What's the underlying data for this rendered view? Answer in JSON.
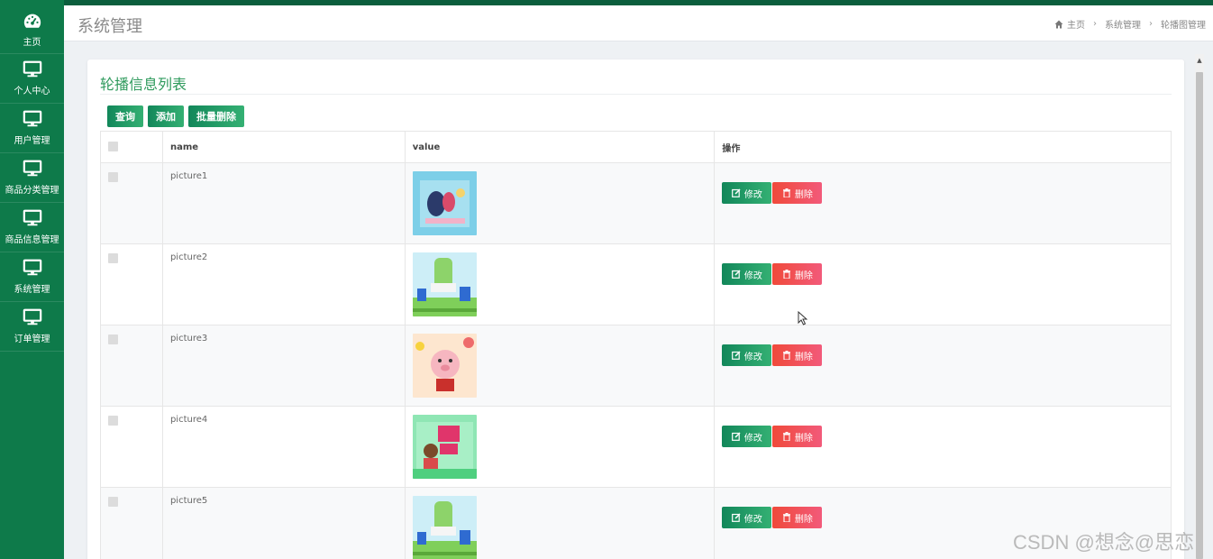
{
  "sidebar": {
    "items": [
      {
        "label": "主页",
        "icon": "dashboard-icon"
      },
      {
        "label": "个人中心",
        "icon": "monitor-icon"
      },
      {
        "label": "用户管理",
        "icon": "monitor-icon"
      },
      {
        "label": "商品分类管理",
        "icon": "monitor-icon"
      },
      {
        "label": "商品信息管理",
        "icon": "monitor-icon"
      },
      {
        "label": "系统管理",
        "icon": "monitor-icon"
      },
      {
        "label": "订单管理",
        "icon": "monitor-icon"
      }
    ]
  },
  "header": {
    "title": "系统管理",
    "breadcrumb": [
      "主页",
      "系统管理",
      "轮播图管理"
    ]
  },
  "card": {
    "title": "轮播信息列表"
  },
  "toolbar": {
    "query_label": "查询",
    "add_label": "添加",
    "batch_delete_label": "批量删除"
  },
  "table": {
    "columns": [
      "name",
      "value",
      "操作"
    ],
    "rows": [
      {
        "name": "picture1",
        "edit": "修改",
        "delete": "删除"
      },
      {
        "name": "picture2",
        "edit": "修改",
        "delete": "删除"
      },
      {
        "name": "picture3",
        "edit": "修改",
        "delete": "删除"
      },
      {
        "name": "picture4",
        "edit": "修改",
        "delete": "删除"
      },
      {
        "name": "picture5",
        "edit": "修改",
        "delete": "删除"
      }
    ]
  },
  "watermark": "CSDN @想念@思恋",
  "colors": {
    "sidebar_bg": "#0e7a4a",
    "topbar": "#0b5e3d",
    "accent_green": "#12875a",
    "danger_red": "#f04a3a",
    "title_green": "#2e9a5c"
  }
}
